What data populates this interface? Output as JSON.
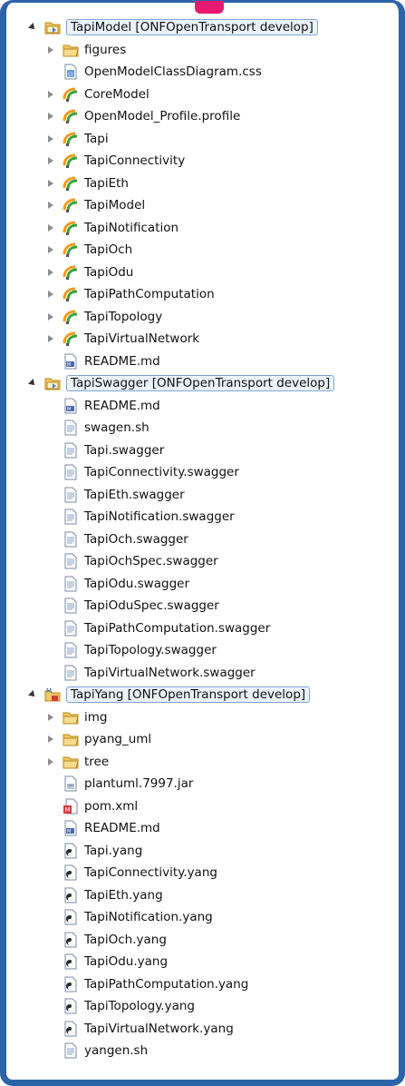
{
  "projects": [
    {
      "label": "TapiModel  [ONFOpenTransport develop]",
      "icon": "project-folder-icon",
      "children": [
        {
          "label": "figures",
          "icon": "folder-icon",
          "toggle": true
        },
        {
          "label": "OpenModelClassDiagram.css",
          "icon": "css-file-icon",
          "toggle": false
        },
        {
          "label": "CoreModel",
          "icon": "uml-model-icon",
          "toggle": true
        },
        {
          "label": "OpenModel_Profile.profile",
          "icon": "uml-model-icon",
          "toggle": true
        },
        {
          "label": "Tapi",
          "icon": "uml-model-icon",
          "toggle": true
        },
        {
          "label": "TapiConnectivity",
          "icon": "uml-model-icon",
          "toggle": true
        },
        {
          "label": "TapiEth",
          "icon": "uml-model-icon",
          "toggle": true
        },
        {
          "label": "TapiModel",
          "icon": "uml-model-icon",
          "toggle": true
        },
        {
          "label": "TapiNotification",
          "icon": "uml-model-icon",
          "toggle": true
        },
        {
          "label": "TapiOch",
          "icon": "uml-model-icon",
          "toggle": true
        },
        {
          "label": "TapiOdu",
          "icon": "uml-model-icon",
          "toggle": true
        },
        {
          "label": "TapiPathComputation",
          "icon": "uml-model-icon",
          "toggle": true
        },
        {
          "label": "TapiTopology",
          "icon": "uml-model-icon",
          "toggle": true
        },
        {
          "label": "TapiVirtualNetwork",
          "icon": "uml-model-icon",
          "toggle": true
        },
        {
          "label": "README.md",
          "icon": "markdown-file-icon",
          "toggle": false
        }
      ]
    },
    {
      "label": "TapiSwagger  [ONFOpenTransport develop]",
      "icon": "project-folder-icon",
      "children": [
        {
          "label": "README.md",
          "icon": "markdown-file-icon",
          "toggle": false
        },
        {
          "label": "swagen.sh",
          "icon": "text-file-icon",
          "toggle": false
        },
        {
          "label": "Tapi.swagger",
          "icon": "text-file-icon",
          "toggle": false
        },
        {
          "label": "TapiConnectivity.swagger",
          "icon": "text-file-icon",
          "toggle": false
        },
        {
          "label": "TapiEth.swagger",
          "icon": "text-file-icon",
          "toggle": false
        },
        {
          "label": "TapiNotification.swagger",
          "icon": "text-file-icon",
          "toggle": false
        },
        {
          "label": "TapiOch.swagger",
          "icon": "text-file-icon",
          "toggle": false
        },
        {
          "label": "TapiOchSpec.swagger",
          "icon": "text-file-icon",
          "toggle": false
        },
        {
          "label": "TapiOdu.swagger",
          "icon": "text-file-icon",
          "toggle": false
        },
        {
          "label": "TapiOduSpec.swagger",
          "icon": "text-file-icon",
          "toggle": false
        },
        {
          "label": "TapiPathComputation.swagger",
          "icon": "text-file-icon",
          "toggle": false
        },
        {
          "label": "TapiTopology.swagger",
          "icon": "text-file-icon",
          "toggle": false
        },
        {
          "label": "TapiVirtualNetwork.swagger",
          "icon": "text-file-icon",
          "toggle": false
        }
      ]
    },
    {
      "label": "TapiYang  [ONFOpenTransport develop]",
      "icon": "maven-project-icon",
      "children": [
        {
          "label": "img",
          "icon": "folder-icon",
          "toggle": true
        },
        {
          "label": "pyang_uml",
          "icon": "folder-icon",
          "toggle": true
        },
        {
          "label": "tree",
          "icon": "folder-icon",
          "toggle": true
        },
        {
          "label": "plantuml.7997.jar",
          "icon": "jar-file-icon",
          "toggle": false
        },
        {
          "label": "pom.xml",
          "icon": "maven-pom-icon",
          "toggle": false
        },
        {
          "label": "README.md",
          "icon": "markdown-file-icon",
          "toggle": false
        },
        {
          "label": "Tapi.yang",
          "icon": "yang-file-icon",
          "toggle": false
        },
        {
          "label": "TapiConnectivity.yang",
          "icon": "yang-file-icon",
          "toggle": false
        },
        {
          "label": "TapiEth.yang",
          "icon": "yang-file-icon",
          "toggle": false
        },
        {
          "label": "TapiNotification.yang",
          "icon": "yang-file-icon",
          "toggle": false
        },
        {
          "label": "TapiOch.yang",
          "icon": "yang-file-icon",
          "toggle": false
        },
        {
          "label": "TapiOdu.yang",
          "icon": "yang-file-icon",
          "toggle": false
        },
        {
          "label": "TapiPathComputation.yang",
          "icon": "yang-file-icon",
          "toggle": false
        },
        {
          "label": "TapiTopology.yang",
          "icon": "yang-file-icon",
          "toggle": false
        },
        {
          "label": "TapiVirtualNetwork.yang",
          "icon": "yang-file-icon",
          "toggle": false
        },
        {
          "label": "yangen.sh",
          "icon": "text-file-icon",
          "toggle": false
        }
      ]
    }
  ],
  "colors": {
    "frame": "#2c63a9",
    "accent_tab": "#e8196e",
    "selection_bg": "#eaf2fb",
    "selection_border": "#7fa6d6",
    "folder": "#f1c75b",
    "uml_green": "#3aa33a",
    "uml_orange": "#f09a1f"
  }
}
